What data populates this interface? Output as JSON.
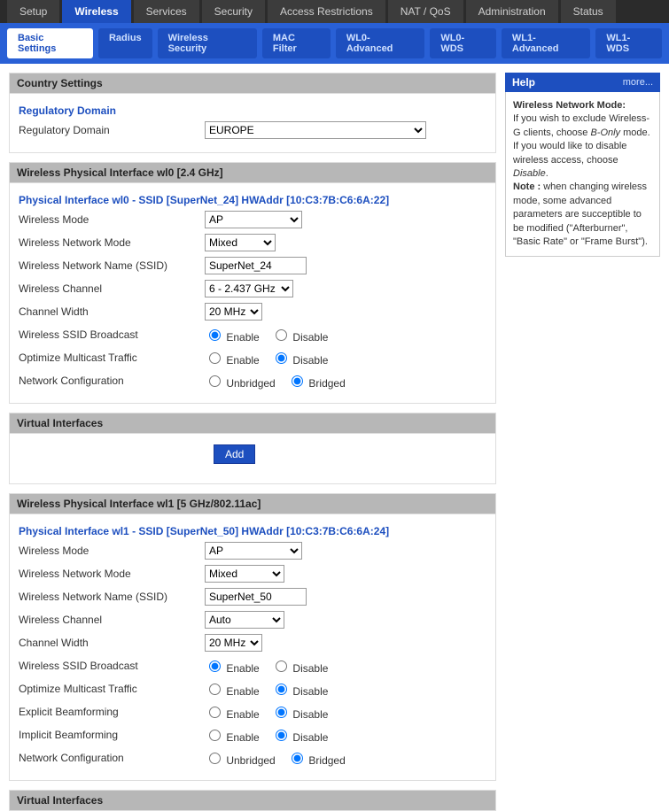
{
  "main_tabs": {
    "items": [
      "Setup",
      "Wireless",
      "Services",
      "Security",
      "Access Restrictions",
      "NAT / QoS",
      "Administration",
      "Status"
    ],
    "active": 1
  },
  "sub_tabs": {
    "items": [
      "Basic Settings",
      "Radius",
      "Wireless Security",
      "MAC Filter",
      "WL0-Advanced",
      "WL0-WDS",
      "WL1-Advanced",
      "WL1-WDS"
    ],
    "active": 0
  },
  "country": {
    "section_title": "Country Settings",
    "sub_title": "Regulatory Domain",
    "label": "Regulatory Domain",
    "value": "EUROPE"
  },
  "wl0": {
    "section_title": "Wireless Physical Interface wl0 [2.4 GHz]",
    "sub_title": "Physical Interface wl0 - SSID [SuperNet_24] HWAddr [10:C3:7B:C6:6A:22]",
    "mode": {
      "label": "Wireless Mode",
      "value": "AP"
    },
    "net_mode": {
      "label": "Wireless Network Mode",
      "value": "Mixed"
    },
    "ssid": {
      "label": "Wireless Network Name (SSID)",
      "value": "SuperNet_24"
    },
    "channel": {
      "label": "Wireless Channel",
      "value": "6 - 2.437 GHz"
    },
    "width": {
      "label": "Channel Width",
      "value": "20 MHz"
    },
    "ssid_bcast": {
      "label": "Wireless SSID Broadcast",
      "enable": "Enable",
      "disable": "Disable",
      "value": "enable"
    },
    "multicast": {
      "label": "Optimize Multicast Traffic",
      "enable": "Enable",
      "disable": "Disable",
      "value": "disable"
    },
    "netconf": {
      "label": "Network Configuration",
      "unbridged": "Unbridged",
      "bridged": "Bridged",
      "value": "bridged"
    }
  },
  "virtual1": {
    "section_title": "Virtual Interfaces",
    "add_label": "Add"
  },
  "wl1": {
    "section_title": "Wireless Physical Interface wl1 [5 GHz/802.11ac]",
    "sub_title": "Physical Interface wl1 - SSID [SuperNet_50] HWAddr [10:C3:7B:C6:6A:24]",
    "mode": {
      "label": "Wireless Mode",
      "value": "AP"
    },
    "net_mode": {
      "label": "Wireless Network Mode",
      "value": "Mixed"
    },
    "ssid": {
      "label": "Wireless Network Name (SSID)",
      "value": "SuperNet_50"
    },
    "channel": {
      "label": "Wireless Channel",
      "value": "Auto"
    },
    "width": {
      "label": "Channel Width",
      "value": "20 MHz"
    },
    "ssid_bcast": {
      "label": "Wireless SSID Broadcast",
      "enable": "Enable",
      "disable": "Disable",
      "value": "enable"
    },
    "multicast": {
      "label": "Optimize Multicast Traffic",
      "enable": "Enable",
      "disable": "Disable",
      "value": "disable"
    },
    "explicit_bf": {
      "label": "Explicit Beamforming",
      "enable": "Enable",
      "disable": "Disable",
      "value": "disable"
    },
    "implicit_bf": {
      "label": "Implicit Beamforming",
      "enable": "Enable",
      "disable": "Disable",
      "value": "disable"
    },
    "netconf": {
      "label": "Network Configuration",
      "unbridged": "Unbridged",
      "bridged": "Bridged",
      "value": "bridged"
    }
  },
  "virtual2": {
    "section_title": "Virtual Interfaces"
  },
  "help": {
    "title": "Help",
    "more": "more...",
    "heading": "Wireless Network Mode:",
    "body1": "If you wish to exclude Wireless-G clients, choose ",
    "body1_i": "B-Only",
    "body1_b": " mode. If you would like to disable wireless access, choose ",
    "body1_i2": "Disable",
    "body1_c": ".",
    "note_label": "Note : ",
    "note": "when changing wireless mode, some advanced parameters are succeptible to be modified (\"Afterburner\", \"Basic Rate\" or \"Frame Burst\")."
  }
}
